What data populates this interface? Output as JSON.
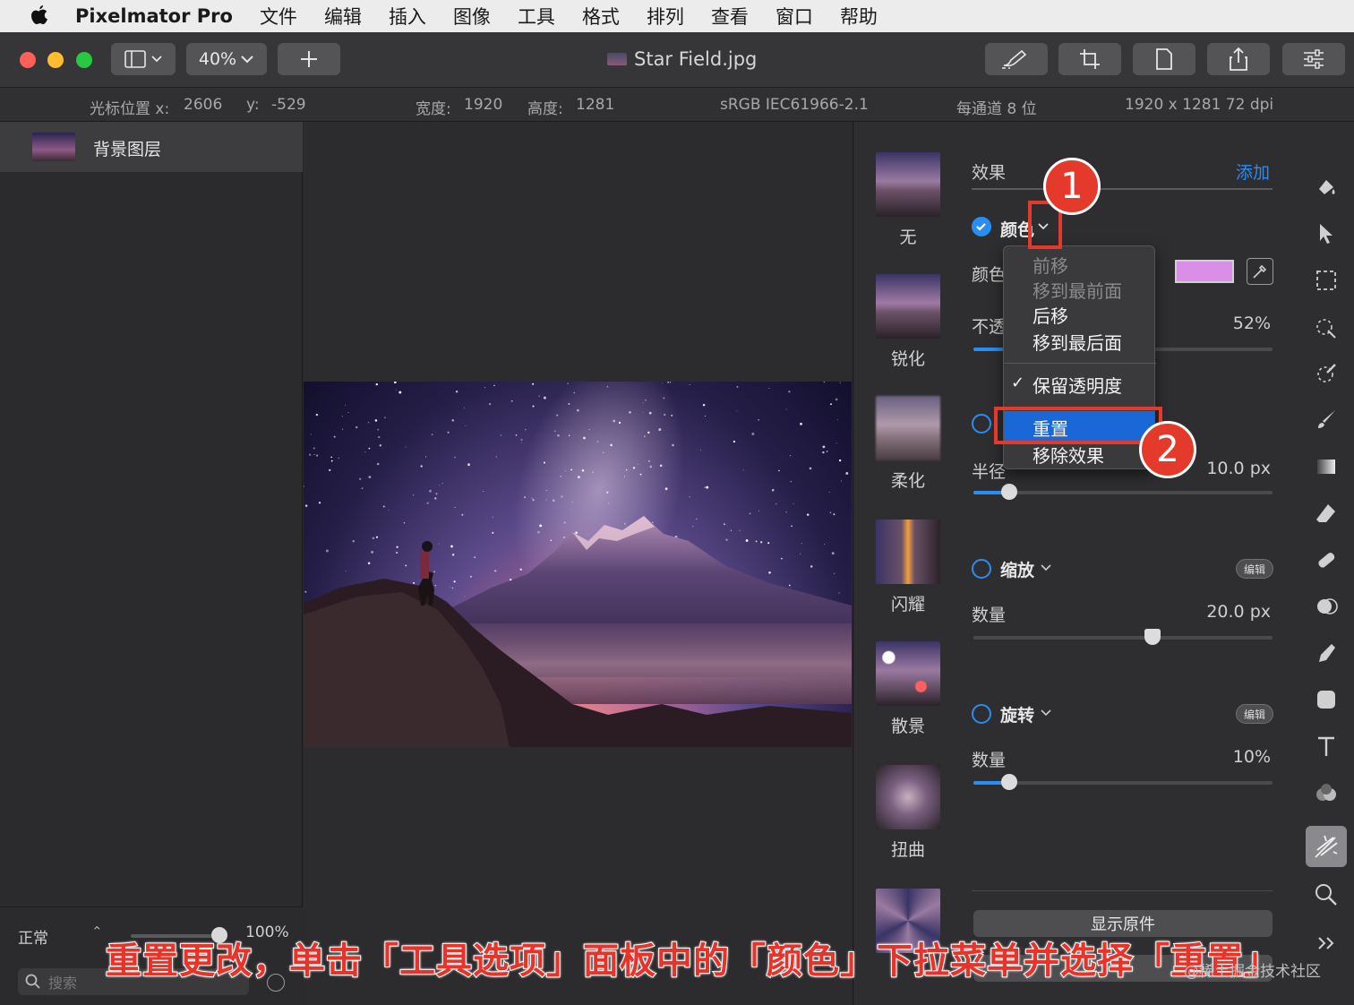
{
  "menubar": {
    "app_name": "Pixelmator Pro",
    "items": [
      "文件",
      "编辑",
      "插入",
      "图像",
      "工具",
      "格式",
      "排列",
      "查看",
      "窗口",
      "帮助"
    ]
  },
  "toolbar": {
    "zoom": "40%",
    "doc_title": "Star Field.jpg"
  },
  "infobar": {
    "cursor_x_label": "光标位置 x:",
    "cursor_x": "2606",
    "cursor_y_label": "y:",
    "cursor_y": "-529",
    "width_label": "宽度:",
    "width": "1920",
    "height_label": "高度:",
    "height": "1281",
    "color_profile": "sRGB IEC61966-2.1",
    "bit_depth": "每通道 8 位",
    "dimensions": "1920 x 1281 72 dpi"
  },
  "layers": {
    "layer_name": "背景图层",
    "blend_mode": "正常",
    "opacity": "100%",
    "search_placeholder": "搜索"
  },
  "effects_panel": {
    "header": "效果",
    "add": "添加",
    "thumbnails": [
      {
        "label": "无"
      },
      {
        "label": "锐化"
      },
      {
        "label": "柔化"
      },
      {
        "label": "闪耀"
      },
      {
        "label": "散景"
      },
      {
        "label": "扭曲"
      }
    ],
    "color_effect": {
      "name": "颜色",
      "prop_color": "颜色",
      "prop_opacity": "不透",
      "opacity_value": "52%",
      "opacity_fraction": 0.52,
      "swatch_color": "#d98ee8"
    },
    "radius": {
      "label": "半径",
      "value": "10.0 px",
      "fraction": 0.12
    },
    "zoom_effect": {
      "name": "缩放",
      "edit": "编辑",
      "amount_label": "数量",
      "amount_value": "20.0 px",
      "fraction": 0.6
    },
    "rotate_effect": {
      "name": "旋转",
      "edit": "编辑",
      "amount_label": "数量",
      "amount_value": "10%",
      "fraction": 0.12
    },
    "show_original": "显示原件"
  },
  "dropdown": {
    "items_disabled": [
      "前移",
      "移到最前面"
    ],
    "items_enabled": [
      "后移",
      "移到最后面"
    ],
    "checked_item": "保留透明度",
    "highlighted_item": "重置",
    "last_item": "移除效果"
  },
  "annotations": {
    "badge_1": "1",
    "badge_2": "2",
    "caption": "重置更改，单击「工具选项」面板中的「颜色」下拉菜单并选择「重置」",
    "watermark": "@稀土掘金技术社区"
  },
  "colors": {
    "accent": "#2a8df2",
    "annotation_red": "#e43a2c",
    "menu_highlight": "#1a68d8"
  }
}
